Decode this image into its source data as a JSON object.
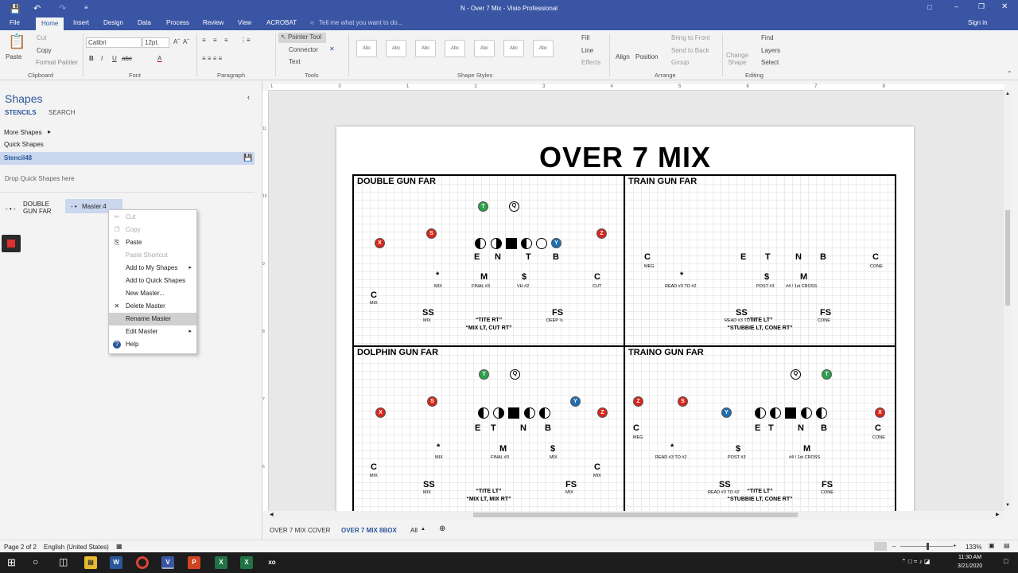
{
  "app": {
    "title": "N - Over 7 Mix - Visio Professional",
    "signin": "Sign in"
  },
  "tabs": [
    "File",
    "Home",
    "Insert",
    "Design",
    "Data",
    "Process",
    "Review",
    "View",
    "ACROBAT"
  ],
  "tellme": "Tell me what you want to do...",
  "ribbon": {
    "paste": "Paste",
    "cut": "Cut",
    "copy": "Copy",
    "format_painter": "Format Painter",
    "font_name": "Calibri",
    "font_size": "12pt.",
    "pointer_tool": "Pointer Tool",
    "connector": "Connector",
    "text": "Text",
    "fill": "Fill",
    "line": "Line",
    "effects": "Effects",
    "align": "Align",
    "position": "Position",
    "bring_front": "Bring to Front",
    "send_back": "Send to Back",
    "group": "Group",
    "change_shape": "Change Shape",
    "find": "Find",
    "layers": "Layers",
    "select": "Select",
    "style_sample": "Abc",
    "groups": {
      "clipboard": "Clipboard",
      "font": "Font",
      "paragraph": "Paragraph",
      "tools": "Tools",
      "shape_styles": "Shape Styles",
      "arrange": "Arrange",
      "editing": "Editing"
    }
  },
  "shapes": {
    "title": "Shapes",
    "stencils": "STENCILS",
    "search": "SEARCH",
    "more_shapes": "More Shapes",
    "quick_shapes": "Quick Shapes",
    "stencil": "Stencil48",
    "drop_hint": "Drop Quick Shapes here",
    "item1": "DOUBLE GUN FAR",
    "item2": "Master.4"
  },
  "context_menu": [
    {
      "label": "Cut",
      "state": "disabled"
    },
    {
      "label": "Copy",
      "state": "disabled"
    },
    {
      "label": "Paste",
      "state": "normal"
    },
    {
      "label": "Paste Shortcut",
      "state": "disabled"
    },
    {
      "label": "Add to My Shapes",
      "state": "normal",
      "sub": true
    },
    {
      "label": "Add to Quick Shapes",
      "state": "normal"
    },
    {
      "label": "New Master...",
      "state": "normal"
    },
    {
      "label": "Delete Master",
      "state": "normal"
    },
    {
      "label": "Rename Master",
      "state": "highlighted"
    },
    {
      "label": "Edit Master",
      "state": "normal",
      "sub": true
    },
    {
      "label": "Help",
      "state": "normal"
    }
  ],
  "ruler_h": [
    "1",
    "0",
    "1",
    "2",
    "3",
    "4",
    "5",
    "6",
    "7",
    "8"
  ],
  "ruler_v": [
    "11",
    "10",
    "9",
    "8",
    "7",
    "6"
  ],
  "doc": {
    "title": "OVER 7 MIX",
    "quads": [
      {
        "title": "DOUBLE GUN FAR",
        "call1": "“TITE RT”",
        "call2": "“MIX LT, CUT RT”"
      },
      {
        "title": "TRAIN GUN FAR",
        "call1": "“TITE LT”",
        "call2": "“STUBBIE LT, CONE RT”"
      },
      {
        "title": "DOLPHIN GUN FAR",
        "call1": "“TITE LT”",
        "call2": "“MIX LT, MIX RT”"
      },
      {
        "title": "TRAINO GUN FAR",
        "call1": "“TITE LT”",
        "call2": "“STUBBIE LT, CONE RT”"
      }
    ],
    "labels": {
      "T": "T",
      "Q": "Q",
      "S": "S",
      "X": "X",
      "Z": "Z",
      "Y": "Y",
      "E": "E",
      "N": "N",
      "B": "B",
      "C": "C",
      "M": "M",
      "dollar": "$",
      "star": "*",
      "SS": "SS",
      "FS": "FS",
      "MIX": "MIX",
      "CUT": "CUT",
      "MEG": "MEG",
      "CONE": "CONE",
      "FINAL3": "FINAL #3",
      "VH2": "VH #2",
      "DEEP": "DEEP ½",
      "READ32": "READ #3 TO #2",
      "POST3": "POST #3",
      "CROSS": "#4 / 1st CROSS"
    }
  },
  "sheet_tabs": {
    "t1": "OVER 7 MIX COVER",
    "t2": "OVER 7 MIX 8BOX",
    "all": "All"
  },
  "status": {
    "page": "Page 2 of 2",
    "lang": "English (United States)",
    "zoom": "133%"
  },
  "clock": {
    "time": "11:30 AM",
    "date": "3/21/2020"
  },
  "colors": {
    "accent": "#3955a3",
    "red": "#d9261c",
    "green": "#2ea14c",
    "blue": "#1f6fb2"
  }
}
